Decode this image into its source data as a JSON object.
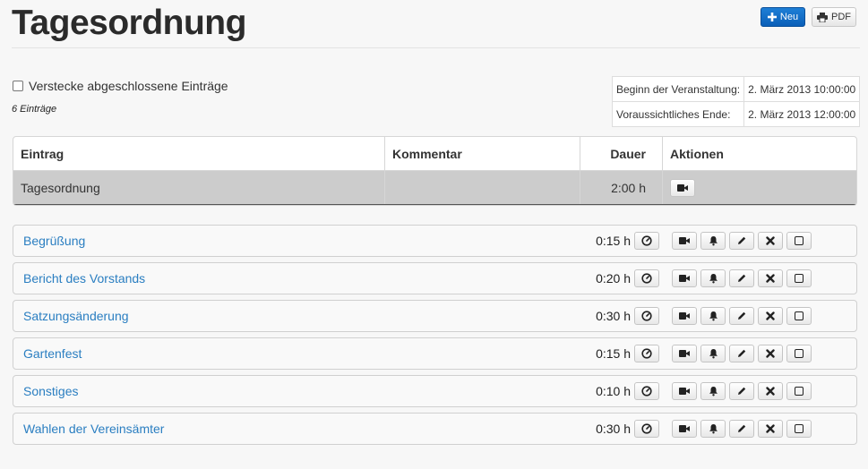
{
  "header": {
    "title": "Tagesordnung",
    "new_button": "Neu",
    "pdf_button": "PDF"
  },
  "filter": {
    "hide_completed_label": "Verstecke abgeschlossene Einträge",
    "hide_completed_checked": false,
    "entry_count": "6 Einträge"
  },
  "event": {
    "start_label": "Beginn der Veranstaltung:",
    "start_value": "2. März 2013 10:00:00",
    "end_label": "Voraussichtliches Ende:",
    "end_value": "2. März 2013 12:00:00"
  },
  "table": {
    "headers": {
      "entry": "Eintrag",
      "comment": "Kommentar",
      "duration": "Dauer",
      "actions": "Aktionen"
    },
    "root": {
      "title": "Tagesordnung",
      "comment": "",
      "duration": "2:00 h"
    }
  },
  "items": [
    {
      "title": "Begrüßung",
      "duration": "0:15 h"
    },
    {
      "title": "Bericht des Vorstands",
      "duration": "0:20 h"
    },
    {
      "title": "Satzungsänderung",
      "duration": "0:30 h"
    },
    {
      "title": "Gartenfest",
      "duration": "0:15 h"
    },
    {
      "title": "Sonstiges",
      "duration": "0:10 h"
    },
    {
      "title": "Wahlen der Vereinsämter",
      "duration": "0:30 h"
    }
  ],
  "icons": {
    "new": "plus-icon",
    "pdf": "print-icon",
    "clock": "clock-icon",
    "camera": "camera-icon",
    "bell": "bell-icon",
    "edit": "pencil-icon",
    "delete": "close-icon",
    "check": "checkbox-icon"
  },
  "colors": {
    "accent": "#0b63c1",
    "link": "#2a7ec1",
    "selected_row": "#cccccc"
  }
}
